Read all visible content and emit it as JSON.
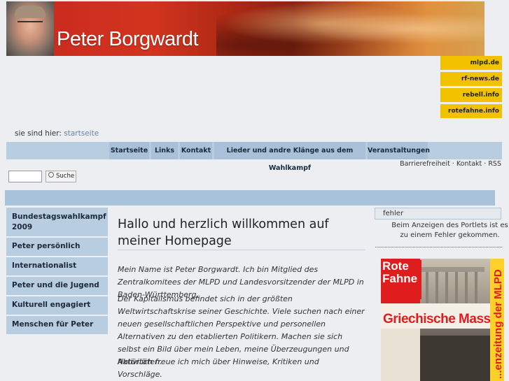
{
  "header": {
    "title": "Peter Borgwardt"
  },
  "external_links": [
    "mlpd.de",
    "rf-news.de",
    "rebell.info",
    "rotefahne.info"
  ],
  "breadcrumb": {
    "prefix": "sie sind hier:",
    "current": "startseite"
  },
  "nav": {
    "tabs": [
      "Startseite",
      "Links",
      "Kontakt",
      "Lieder und andre Klänge aus dem Wahlkampf",
      "Veranstaltungen"
    ]
  },
  "site_actions": "Barrierefreiheit · Kontakt · RSS",
  "search": {
    "button_label": "Suche",
    "value": ""
  },
  "sidebar": {
    "items": [
      "Bundestagswahlkampf 2009",
      "Peter persönlich",
      "Internationalist",
      "Peter und die Jugend",
      "Kulturell engagiert",
      "Menschen für Peter"
    ]
  },
  "main": {
    "title": "Hallo und herzlich willkommen auf meiner Homepage",
    "paragraphs": [
      "Mein Name ist Peter Borgwardt. Ich bin Mitglied des Zentralkomitees der MLPD und Landesvorsitzender der MLPD in Baden-Württemberg.",
      "Der Kapitalismus befindet sich in der größten Weltwirtschaftskrise seiner Geschichte. Viele suchen nach einer neuen gesellschaftlichen Perspektive und personellen Alternativen zu den etablierten Politikern. Machen sie sich selbst ein Bild über mein Leben, meine Überzeugungen und Aktivitäten.",
      "Natürlich freue ich mich über Hinweise, Kritiken und Vorschläge."
    ]
  },
  "portlet": {
    "header": "fehler",
    "message": "Beim Anzeigen des Portlets ist es zu einem Fehler gekommen."
  },
  "newspaper": {
    "logo_line1": "Rote",
    "logo_line2": "Fahne",
    "headline": "Griechische Massen:",
    "side_text": "...enzeitung der MLPD"
  },
  "colors": {
    "nav_bg": "#b8cde0",
    "accent_yellow": "#f2c200",
    "newspaper_red": "#e01d1d"
  }
}
